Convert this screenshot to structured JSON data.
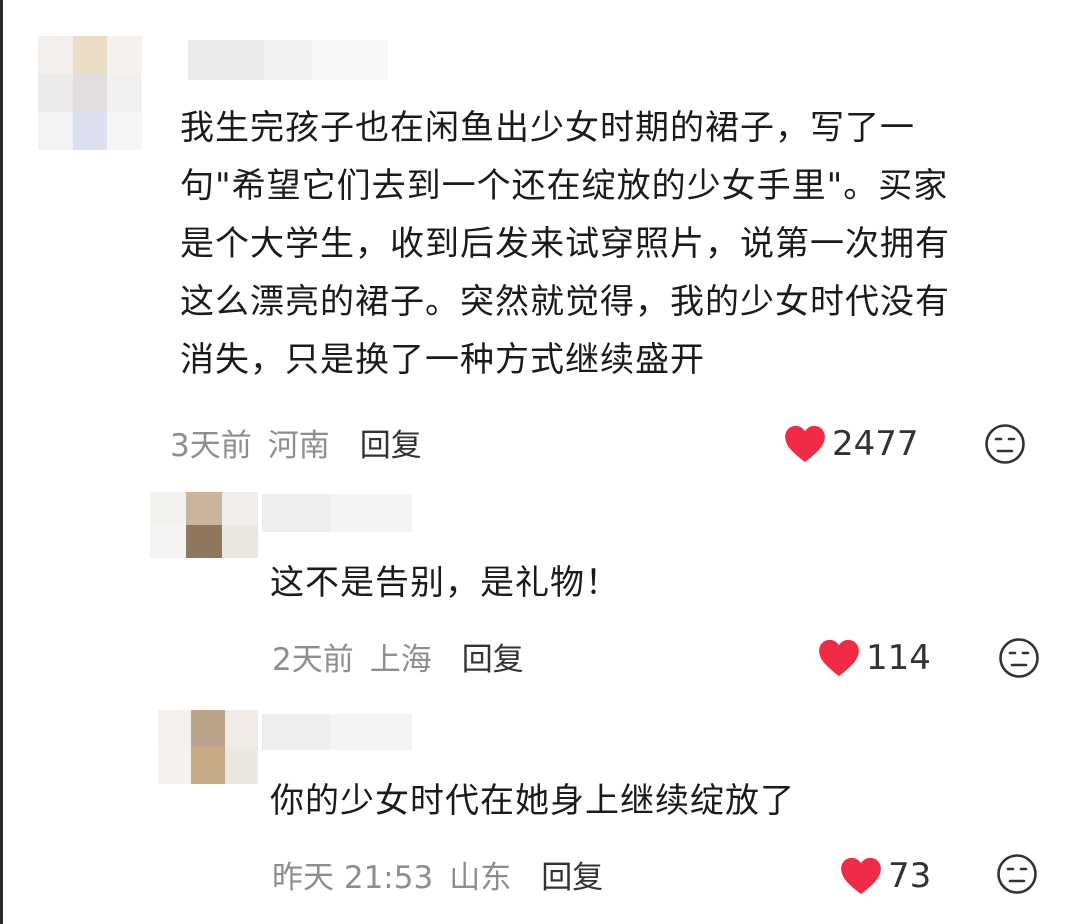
{
  "colors": {
    "heart": "#f02b46",
    "meta_text": "#8e8e8e",
    "reply_text": "#333333",
    "body_text": "#1b1b1b"
  },
  "icons": {
    "like": "heart-icon",
    "dislike": "unamused-face-icon"
  },
  "comments": [
    {
      "lines": [
        "我生完孩子也在闲鱼出少女时期的裙子，写了一",
        "句\"希望它们去到一个还在绽放的少女手里\"。买家",
        "是个大学生，收到后发来试穿照片，说第一次拥有",
        "这么漂亮的裙子。突然就觉得，我的少女时代没有",
        "消失，只是换了一种方式继续盛开"
      ],
      "time": "3天前",
      "location": "河南",
      "reply_label": "回复",
      "likes": "2477"
    },
    {
      "lines": [
        "这不是告别，是礼物！"
      ],
      "time": "2天前",
      "location": "上海",
      "reply_label": "回复",
      "likes": "114"
    },
    {
      "lines": [
        "你的少女时代在她身上继续绽放了"
      ],
      "time": "昨天 21:53",
      "location": "山东",
      "reply_label": "回复",
      "likes": "73"
    }
  ]
}
